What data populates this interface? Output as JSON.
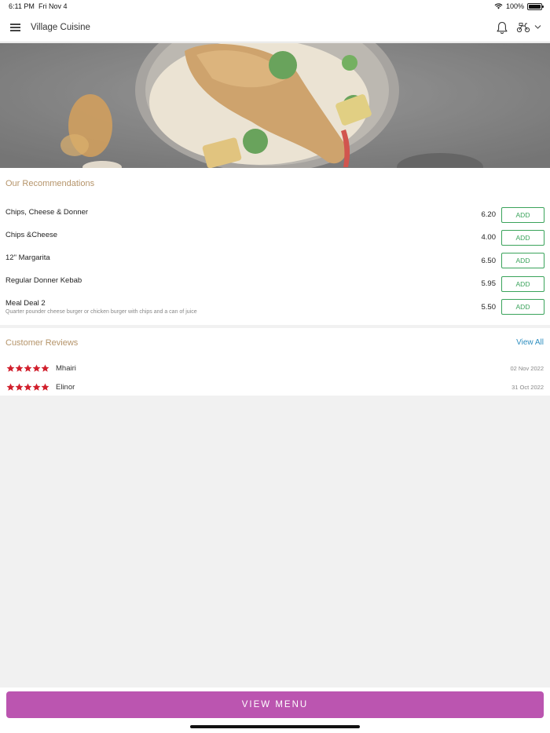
{
  "status_bar": {
    "time": "6:11 PM",
    "date": "Fri Nov 4",
    "battery": "100%"
  },
  "header": {
    "title": "Village Cuisine"
  },
  "recommendations": {
    "title": "Our Recommendations",
    "items": [
      {
        "name": "Chips, Cheese & Donner",
        "description": "",
        "price": "6.20",
        "button": "ADD"
      },
      {
        "name": "Chips &Cheese",
        "description": "",
        "price": "4.00",
        "button": "ADD"
      },
      {
        "name": "12\" Margarita",
        "description": "",
        "price": "6.50",
        "button": "ADD"
      },
      {
        "name": "Regular Donner Kebab",
        "description": "",
        "price": "5.95",
        "button": "ADD"
      },
      {
        "name": "Meal Deal 2",
        "description": "Quarter pounder cheese burger or chicken burger with chips and a can of juice",
        "price": "5.50",
        "button": "ADD"
      }
    ]
  },
  "reviews": {
    "title": "Customer Reviews",
    "view_all": "View All",
    "entries": [
      {
        "name": "Mhairi",
        "date": "02 Nov 2022",
        "rating": 5
      },
      {
        "name": "Elinor",
        "date": "31 Oct 2022",
        "rating": 5
      }
    ]
  },
  "footer": {
    "button": "VIEW MENU"
  },
  "colors": {
    "accent": "#bb55b0",
    "add": "#3aa35b",
    "section_title": "#b5946a",
    "star": "#d1202d",
    "link": "#2f8fc0"
  }
}
